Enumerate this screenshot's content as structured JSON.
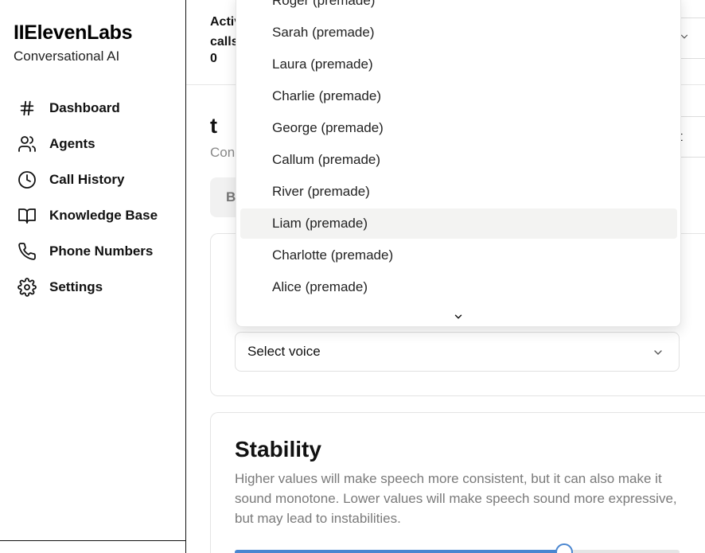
{
  "sidebar": {
    "brand": "IIElevenLabs",
    "subtitle": "Conversational AI",
    "items": [
      {
        "label": "Dashboard",
        "icon": "hash-icon"
      },
      {
        "label": "Agents",
        "icon": "users-icon"
      },
      {
        "label": "Call History",
        "icon": "clock-icon"
      },
      {
        "label": "Knowledge Base",
        "icon": "book-icon"
      },
      {
        "label": "Phone Numbers",
        "icon": "phone-icon"
      },
      {
        "label": "Settings",
        "icon": "gear-icon"
      }
    ]
  },
  "header": {
    "active_calls_label": "Active calls",
    "active_calls_value": "0"
  },
  "agent": {
    "title": "t",
    "subtitle": "Con",
    "right_button_label": "t",
    "tab_label": "B"
  },
  "voice": {
    "select_value": "Select voice",
    "options": [
      "Roger (premade)",
      "Sarah (premade)",
      "Laura (premade)",
      "Charlie (premade)",
      "George (premade)",
      "Callum (premade)",
      "River (premade)",
      "Liam (premade)",
      "Charlotte (premade)",
      "Alice (premade)"
    ],
    "highlighted_index": 7
  },
  "stability": {
    "title": "Stability",
    "description": "Higher values will make speech more consistent, but it can also make it sound monotone. Lower values will make speech sound more expressive, but may lead to instabilities.",
    "value_fraction": 0.74
  },
  "colors": {
    "accent": "#4a86d0",
    "highlight": "#f3f3f2"
  }
}
